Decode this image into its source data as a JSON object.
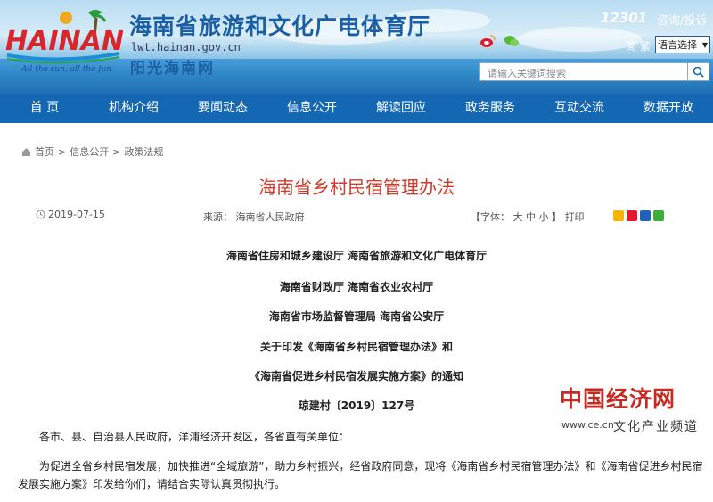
{
  "header": {
    "logo_text": "HAINAN",
    "logo_tagline": "All the sun, all the fun",
    "site_title": "海南省旅游和文化广电体育厅",
    "site_domain": "lwt.hainan.gov.cn",
    "site_slogan": "阳光海南网",
    "hotline": "12301",
    "consult_label": "咨询/投诉",
    "simplified_label": "简 繁",
    "language_select": "语言选择",
    "search_placeholder": "请输入关键词搜索"
  },
  "nav": {
    "items": [
      "首 页",
      "机构介绍",
      "要闻动态",
      "信息公开",
      "解读回应",
      "政务服务",
      "互动交流",
      "数据开放"
    ]
  },
  "breadcrumb": {
    "items": [
      "首页",
      "信息公开",
      "政策法规"
    ],
    "separator": ">"
  },
  "article": {
    "title": "海南省乡村民宿管理办法",
    "date": "2019-07-15",
    "source_label": "来源：",
    "source": "海南省人民政府",
    "font_label": "【字体：",
    "font_sizes": "大 中 小",
    "font_close": "】",
    "print_label": "打印",
    "issuers": [
      "海南省住房和城乡建设厅    海南省旅游和文化广电体育厅",
      "海南省财政厅    海南省农业农村厅",
      "海南省市场监督管理局    海南省公安厅"
    ],
    "notice_title_1": "关于印发《海南省乡村民宿管理办法》和",
    "notice_title_2": "《海南省促进乡村民宿发展实施方案》的通知",
    "doc_number": "琼建村〔2019〕127号",
    "recipients": "各市、县、自治县人民政府，洋浦经济开发区，各省直有关单位：",
    "body_1": "为促进全省乡村民宿发展，加快推进“全域旅游”，助力乡村振兴，经省政府同意，现将《海南省乡村民宿管理办法》和《海南省促进乡村民宿发展实施方案》印发给你们，请结合实际认真贯彻执行。"
  },
  "watermark": {
    "main": "中国经济网",
    "url": "www.ce.cn",
    "sub": "文化产业频道"
  },
  "colors": {
    "nav_bg": "#1467b3",
    "title_red": "#d23a2a",
    "brand_blue": "#1a5fa5"
  }
}
